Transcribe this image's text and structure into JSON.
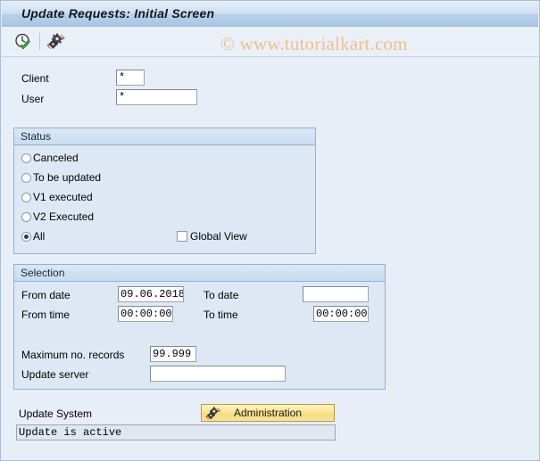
{
  "window": {
    "title": "Update Requests: Initial Screen"
  },
  "toolbar": {
    "execute_icon": "clock-check-icon",
    "execute_tooltip": "Execute",
    "administration_icon": "gears-refresh-icon",
    "administration_tooltip": "Administration"
  },
  "watermark": {
    "text": "© www.tutorialkart.com"
  },
  "header_fields": {
    "client": {
      "label": "Client",
      "value": "*",
      "placeholder": ""
    },
    "user": {
      "label": "User",
      "value": "*",
      "placeholder": ""
    }
  },
  "status_group": {
    "title": "Status",
    "selected": "All",
    "options": [
      {
        "label": "Canceled",
        "selected": false
      },
      {
        "label": "To be updated",
        "selected": false
      },
      {
        "label": "V1 executed",
        "selected": false
      },
      {
        "label": "V2 Executed",
        "selected": false
      },
      {
        "label": "All",
        "selected": true
      }
    ],
    "global_view": {
      "label": "Global View",
      "checked": false
    }
  },
  "selection_group": {
    "title": "Selection",
    "from_date": {
      "label": "From date",
      "value": "09.06.2018"
    },
    "to_date": {
      "label": "To date",
      "value": ""
    },
    "from_time": {
      "label": "From time",
      "value": "00:00:00"
    },
    "to_time": {
      "label": "To time",
      "value": "00:00:00"
    },
    "max_records": {
      "label": "Maximum no. records",
      "value": "99.999"
    },
    "update_server": {
      "label": "Update server",
      "value": ""
    }
  },
  "update_system": {
    "label": "Update System",
    "button_label": "Administration",
    "button_icon": "gears-refresh-icon",
    "status_text": "Update is active"
  },
  "colors": {
    "page_background": "#e8eef7",
    "titlebar_gradient_top": "#e4edf7",
    "titlebar_gradient_bottom": "#a9c6e4",
    "group_background": "#dde8f4",
    "group_border": "#8fb0d1",
    "button_accent": "#f7dc7c",
    "watermark": "#efc08a"
  }
}
